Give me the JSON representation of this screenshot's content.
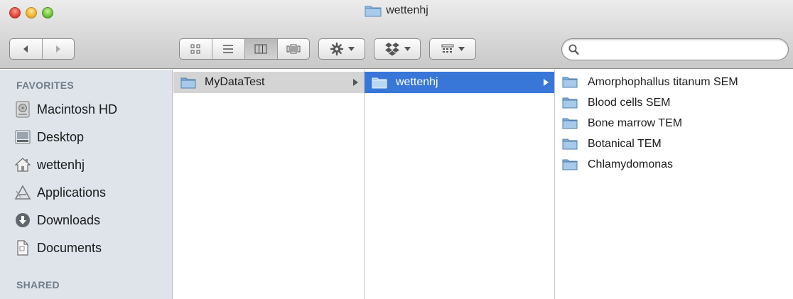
{
  "window": {
    "title": "wettenhj"
  },
  "toolbar": {
    "back_icon": "back-arrow-icon",
    "forward_icon": "forward-arrow-icon",
    "view_modes": [
      "icon-view",
      "list-view",
      "column-view",
      "cover-flow-view"
    ],
    "active_view": "column-view",
    "action_icon": "gear-icon",
    "dropbox_icon": "dropbox-icon",
    "arrange_icon": "arrange-icon",
    "search_placeholder": ""
  },
  "sidebar": {
    "favorites_heading": "FAVORITES",
    "items": [
      {
        "label": "Macintosh HD",
        "icon": "hard-drive-icon"
      },
      {
        "label": "Desktop",
        "icon": "desktop-icon"
      },
      {
        "label": "wettenhj",
        "icon": "home-icon"
      },
      {
        "label": "Applications",
        "icon": "applications-icon"
      },
      {
        "label": "Downloads",
        "icon": "downloads-icon"
      },
      {
        "label": "Documents",
        "icon": "documents-icon"
      }
    ],
    "shared_heading": "SHARED"
  },
  "columns": [
    {
      "items": [
        {
          "name": "MyDataTest",
          "selected": "inactive"
        }
      ]
    },
    {
      "items": [
        {
          "name": "wettenhj",
          "selected": "active"
        }
      ]
    },
    {
      "items": [
        {
          "name": "Amorphophallus titanum SEM"
        },
        {
          "name": "Blood cells SEM"
        },
        {
          "name": "Bone marrow TEM"
        },
        {
          "name": "Botanical TEM"
        },
        {
          "name": "Chlamydomonas"
        }
      ]
    }
  ],
  "colors": {
    "selection_blue": "#3876d8",
    "sidebar_bg": "#dee4ea",
    "folder_blue": "#8fb8e0"
  }
}
